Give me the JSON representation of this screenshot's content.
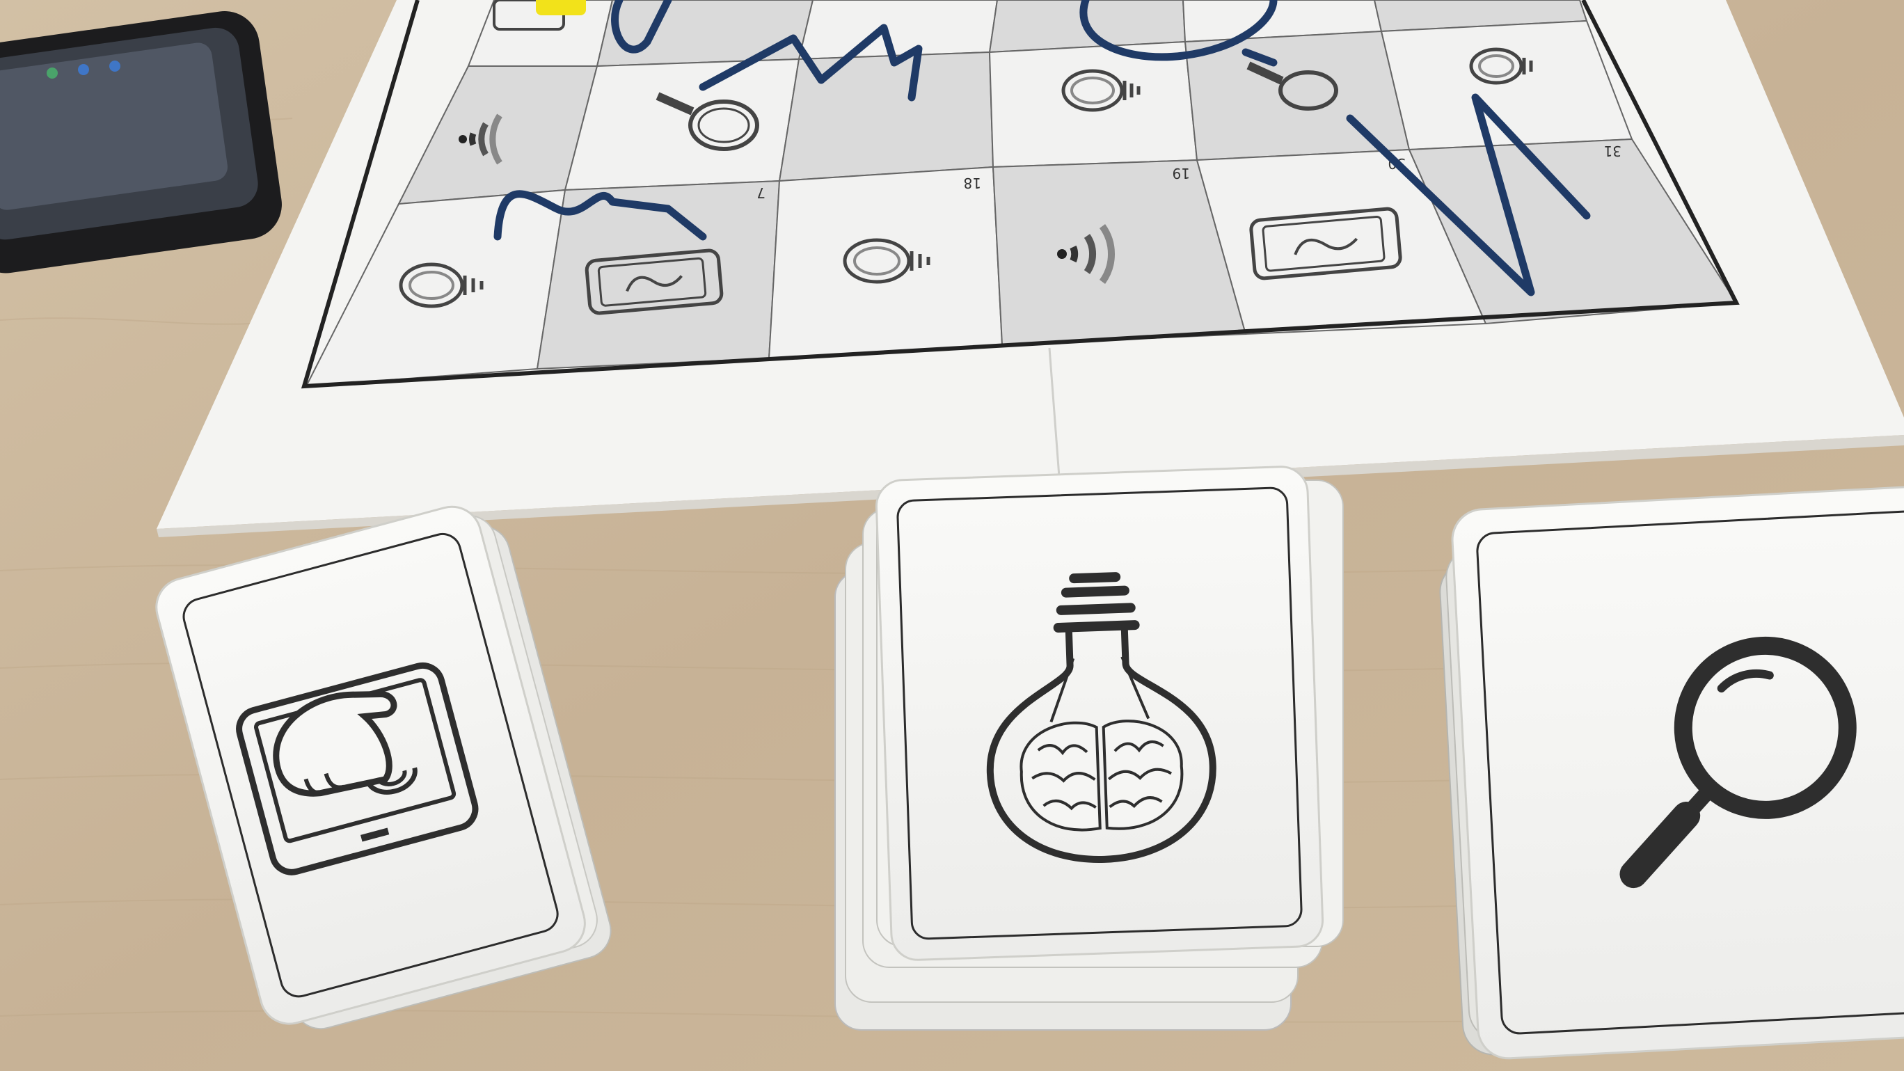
{
  "scene": {
    "description_type": "photograph",
    "colors": {
      "table": "#cbb89d",
      "board": "#f4f4f2",
      "cell_light": "#f2f2f1",
      "cell_dark": "#dadada",
      "ink_blue": "#1f3a66",
      "card": "#f7f7f5",
      "phone": "#1c1c1e",
      "token": "#f2e21a"
    }
  },
  "board": {
    "cells": [
      {
        "row": 0,
        "col": 0,
        "icon": "touchscreen-icon",
        "number": ""
      },
      {
        "row": 0,
        "col": 1,
        "icon": "",
        "number": ""
      },
      {
        "row": 0,
        "col": 2,
        "icon": "",
        "number": ""
      },
      {
        "row": 0,
        "col": 3,
        "icon": "",
        "number": ""
      },
      {
        "row": 0,
        "col": 4,
        "icon": "",
        "number": ""
      },
      {
        "row": 0,
        "col": 5,
        "icon": "",
        "number": ""
      },
      {
        "row": 1,
        "col": 0,
        "icon": "wifi-icon",
        "number": ""
      },
      {
        "row": 1,
        "col": 1,
        "icon": "magnifier-icon",
        "number": ""
      },
      {
        "row": 1,
        "col": 2,
        "icon": "",
        "number": ""
      },
      {
        "row": 1,
        "col": 3,
        "icon": "lightbulb-brain-icon",
        "number": ""
      },
      {
        "row": 1,
        "col": 4,
        "icon": "magnifier-icon",
        "number": ""
      },
      {
        "row": 1,
        "col": 5,
        "icon": "lightbulb-brain-icon",
        "number": ""
      },
      {
        "row": 2,
        "col": 0,
        "icon": "lightbulb-brain-icon",
        "number": ""
      },
      {
        "row": 2,
        "col": 1,
        "icon": "touchscreen-icon",
        "number": "7"
      },
      {
        "row": 2,
        "col": 2,
        "icon": "lightbulb-brain-icon",
        "number": "18"
      },
      {
        "row": 2,
        "col": 3,
        "icon": "wifi-icon",
        "number": "19"
      },
      {
        "row": 2,
        "col": 4,
        "icon": "touchscreen-icon",
        "number": "30"
      },
      {
        "row": 2,
        "col": 5,
        "icon": "",
        "number": "31"
      }
    ]
  },
  "cards": [
    {
      "deck": "left",
      "icon": "touchscreen-icon"
    },
    {
      "deck": "center",
      "icon": "lightbulb-brain-icon"
    },
    {
      "deck": "right",
      "icon": "magnifier-icon"
    }
  ]
}
